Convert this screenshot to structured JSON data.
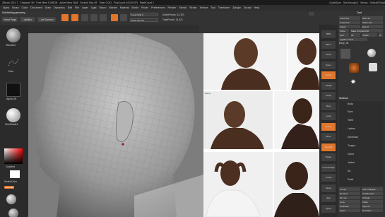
{
  "titlebar": {
    "items": [
      "ZBrush 2021.7",
      "Character 3H",
      "Free Mem 9.295GB",
      "Active Mem 2648",
      "Scratch Disk 48",
      "Timer 0.001",
      "PolyCount 6 (0.00 KP)",
      "MeshCount 1"
    ],
    "right_items": [
      "QuickSave",
      "See-through 0",
      "Menus",
      "DefaultZScript"
    ]
  },
  "menubar": {
    "items": [
      "Alpha",
      "Brush",
      "Color",
      "Document",
      "Draw",
      "Dynamics",
      "Edit",
      "File",
      "Layer",
      "Light",
      "Macro",
      "Marker",
      "Material",
      "Movie",
      "Picker",
      "Preferences",
      "Render",
      "Stencil",
      "Stroke",
      "Texture",
      "Tool",
      "Transform",
      "Zplugin",
      "Zscript",
      "Help"
    ]
  },
  "status": {
    "text": "Subdividing geometry..."
  },
  "toolbar": {
    "home_page": "Home Page",
    "lightbox": "LightBox",
    "live_boolean": "Live Boolean",
    "edit": "Edit",
    "draw": "Draw",
    "move": "Move",
    "scale": "Scale",
    "rotate": "Rotate",
    "mrgb": "Mrgb",
    "rgb": "Rgb",
    "m": "M",
    "zadd": "Zadd",
    "zsub": "Zsub",
    "focal_shift": "Focal Shift 0",
    "draw_size": "Draw Size 64",
    "active_points": "ActivePoints: 14,321",
    "total_points": "TotalPoints: 14,321",
    "rgb_intensity": "Rgb Intensity",
    "z_intensity": "Z Intensity 25",
    "dynamic": "Dynamic"
  },
  "leftshelf": {
    "standard": "Standard",
    "dots": "Dots",
    "alpha_off": "Alpha Off",
    "texture_off": "Texture Off",
    "skin_shade": "SkinShade4",
    "gradient": "Gradient",
    "switch_color": "SwitchColor",
    "alternate": "Alternate"
  },
  "rshelf": {
    "items": [
      "BPR",
      "SPix 3",
      "Scroll",
      "Zoom",
      "Actual",
      "AAHalf",
      "Persp",
      "Floor",
      "Local",
      "Frame",
      "Move",
      "Zoom3D",
      "Rotate",
      "Line Fill PolyF",
      "Transp",
      "Ghost",
      "Solo",
      "Xpose"
    ]
  },
  "rpanel": {
    "title": "Tool",
    "load_tool": "Load Tool",
    "save_as": "Save As",
    "copy_tool": "Copy Tool",
    "paste_tool": "Paste Tool",
    "import": "Import",
    "export": "Export",
    "clone": "Clone",
    "make_polymesh": "Make PolyMesh3D",
    "goz": "GoZ",
    "all": "All",
    "visible": "Visible",
    "r": "R",
    "lightbox_tools": "Lightbox Tools",
    "body": "Body_48",
    "tool_names": [
      "Body_48",
      "SphereBrush",
      "AlphaBrush",
      "SimpleBrush",
      "EraserBrush",
      "Cylinder3D",
      "PolyMesh3D"
    ],
    "subtool": "Subtool",
    "subtool_items": [
      "Body",
      "Eyes",
      "Teeth",
      "Lashes",
      "Eyebrows",
      "Tongue",
      "Gums",
      "Jacket",
      "Sh...",
      "Soleil"
    ],
    "list_all": "List All",
    "new_folder": "New Folder",
    "rename": "Rename",
    "auto_reorder": "AutoReorder",
    "all_low": "All Low",
    "all_high": "All High",
    "copy": "Copy",
    "paste": "Paste",
    "duplicate": "Duplicate",
    "append": "Append",
    "insert": "Insert",
    "del_other": "Del Other",
    "auto_collapse": "Auto Collapse",
    "vis": "Vis 3.6"
  },
  "photos": {
    "alamy": "alamy",
    "stock_photo": "a alamy stock photo",
    "shutterstock": "shutterstock",
    "istock": "iStock"
  }
}
